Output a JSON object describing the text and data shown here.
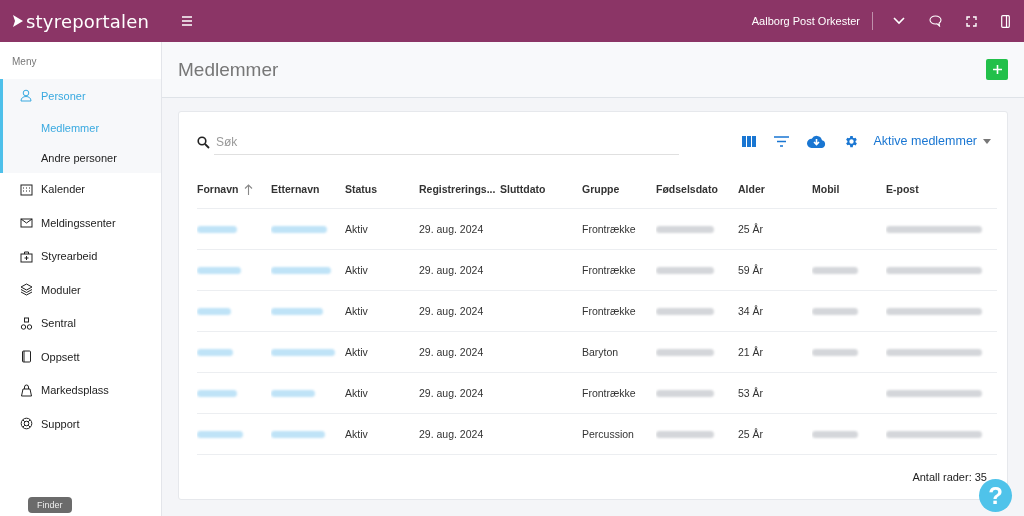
{
  "topbar": {
    "logo": "styreportalen",
    "organization": "Aalborg Post Orkester"
  },
  "sidebar": {
    "heading": "Meny",
    "items": [
      {
        "label": "Personer",
        "selected": true,
        "children": [
          {
            "label": "Medlemmer",
            "selected": true
          },
          {
            "label": "Andre personer",
            "selected": false
          }
        ]
      },
      {
        "label": "Kalender",
        "selected": false
      },
      {
        "label": "Meldingssenter",
        "selected": false
      },
      {
        "label": "Styrearbeid",
        "selected": false
      },
      {
        "label": "Moduler",
        "selected": false
      },
      {
        "label": "Sentral",
        "selected": false
      },
      {
        "label": "Oppsett",
        "selected": false
      },
      {
        "label": "Markedsplass",
        "selected": false
      },
      {
        "label": "Support",
        "selected": false
      }
    ]
  },
  "page": {
    "title": "Medlemmer"
  },
  "toolbar": {
    "search": {
      "placeholder": "Søk"
    },
    "filter_dropdown": "Aktive medlemmer"
  },
  "table": {
    "columns": [
      {
        "label": "Fornavn",
        "sorted": true
      },
      {
        "label": "Etternavn",
        "sorted": false
      },
      {
        "label": "Status",
        "sorted": false
      },
      {
        "label": "Registrerings...",
        "sorted": false
      },
      {
        "label": "Sluttdato",
        "sorted": false
      },
      {
        "label": "Gruppe",
        "sorted": false
      },
      {
        "label": "Fødselsdato",
        "sorted": false
      },
      {
        "label": "Alder",
        "sorted": false
      },
      {
        "label": "Mobil",
        "sorted": false
      },
      {
        "label": "E-post",
        "sorted": false
      }
    ],
    "rows": [
      {
        "status": "Aktiv",
        "registered": "29. aug. 2024",
        "group": "Frontrække",
        "age": "25 År",
        "mobile_blurred": false
      },
      {
        "status": "Aktiv",
        "registered": "29. aug. 2024",
        "group": "Frontrække",
        "age": "59 År",
        "mobile_blurred": true
      },
      {
        "status": "Aktiv",
        "registered": "29. aug. 2024",
        "group": "Frontrække",
        "age": "34 År",
        "mobile_blurred": true
      },
      {
        "status": "Aktiv",
        "registered": "29. aug. 2024",
        "group": "Baryton",
        "age": "21 År",
        "mobile_blurred": true
      },
      {
        "status": "Aktiv",
        "registered": "29. aug. 2024",
        "group": "Frontrække",
        "age": "53 År",
        "mobile_blurred": false
      },
      {
        "status": "Aktiv",
        "registered": "29. aug. 2024",
        "group": "Percussion",
        "age": "25 År",
        "mobile_blurred": true
      }
    ],
    "row_count": "Antall rader: 35"
  },
  "help_button": "?",
  "os_tooltip": "Finder"
}
